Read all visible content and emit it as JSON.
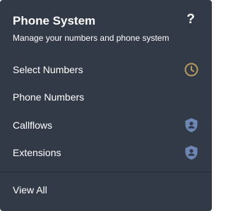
{
  "header": {
    "title": "Phone System",
    "subtitle": "Manage your numbers and phone system",
    "help_label": "?"
  },
  "menu": {
    "items": [
      {
        "label": "Select Numbers",
        "icon": "clock-icon",
        "icon_color": "#b69a5a"
      },
      {
        "label": "Phone Numbers",
        "icon": null
      },
      {
        "label": "Callflows",
        "icon": "shield-user-icon",
        "icon_color": "#6d86b3"
      },
      {
        "label": "Extensions",
        "icon": "shield-user-icon",
        "icon_color": "#6d86b3"
      }
    ]
  },
  "footer": {
    "view_all_label": "View All"
  },
  "colors": {
    "panel_background": "#323a48",
    "text": "#ffffff",
    "divider": "#262c37"
  }
}
